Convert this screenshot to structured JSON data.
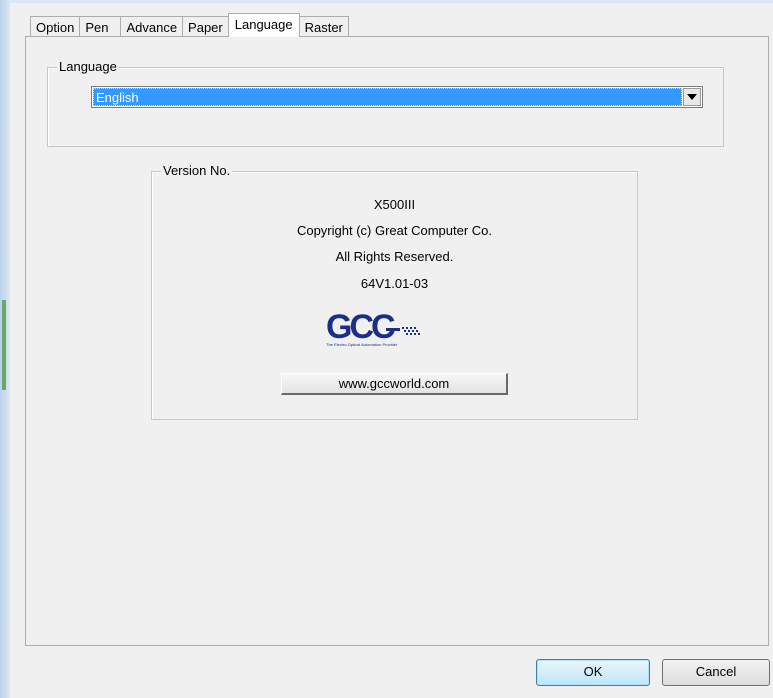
{
  "tabs": [
    {
      "label": "Option",
      "active": false
    },
    {
      "label": "Pen",
      "active": false
    },
    {
      "label": "Advance",
      "active": false
    },
    {
      "label": "Paper",
      "active": false
    },
    {
      "label": "Language",
      "active": true
    },
    {
      "label": "Raster",
      "active": false
    }
  ],
  "language_group": {
    "title": "Language",
    "selected": "English"
  },
  "version_group": {
    "title": "Version No.",
    "model": "X500III",
    "copyright": "Copyright (c) Great Computer Co.",
    "rights": "All Rights Reserved.",
    "version": "64V1.01-03",
    "logo": {
      "text": "GCC",
      "tagline": "The Electro-Optical Automation Provider",
      "color": "#1b2f86"
    },
    "website_button": "www.gccworld.com"
  },
  "buttons": {
    "ok": "OK",
    "cancel": "Cancel"
  },
  "colors": {
    "selection": "#3399ff",
    "ok_border": "#3c7fb1"
  }
}
